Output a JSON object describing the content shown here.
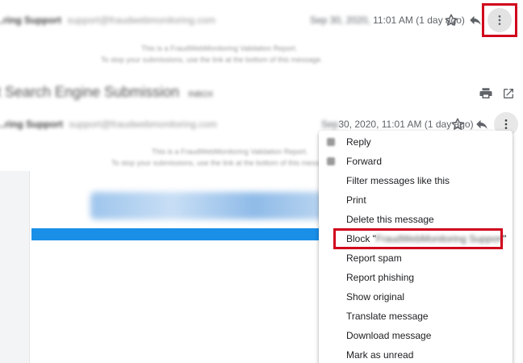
{
  "top_message": {
    "sender_name": "...ring Support",
    "sender_email": "support@fraudwebmonitoring.com",
    "date_prefix": "Sep 30, 2020,",
    "date": "11:01 AM (1 day ago)",
    "body_line1": "This is a FraudWebMonitoring Validation Report.",
    "body_line2": "To stop your submissions, use the link at the bottom of this message."
  },
  "subject": {
    "text": "t Search Engine Submission",
    "badge": "INBOX"
  },
  "second_message": {
    "sender_name": "...ring Support",
    "sender_email": "support@fraudwebmonitoring.com",
    "date_prefix": "Sep",
    "date": "30, 2020, 11:01 AM (1 day ago)",
    "body_line1": "This is a FraudWebMonitoring Validation Report.",
    "body_line2": "To stop your submissions, use the link at the bottom of this message."
  },
  "menu": {
    "items": [
      {
        "label": "Reply"
      },
      {
        "label": "Forward"
      },
      {
        "label": "Filter messages like this"
      },
      {
        "label": "Print"
      },
      {
        "label": "Delete this message"
      },
      {
        "label": "Block \"",
        "blocked": "FraudWebMonitoring Support",
        "suffix": "\""
      },
      {
        "label": "Report spam"
      },
      {
        "label": "Report phishing"
      },
      {
        "label": "Show original"
      },
      {
        "label": "Translate message"
      },
      {
        "label": "Download message"
      },
      {
        "label": "Mark as unread"
      }
    ]
  },
  "colors": {
    "highlight_red": "#d0021b",
    "banner_blue": "#1a8fe8"
  },
  "icons": {
    "star": "star-icon",
    "reply": "reply-icon",
    "more": "more-vertical-icon",
    "print": "print-icon",
    "open": "open-in-new-icon"
  }
}
